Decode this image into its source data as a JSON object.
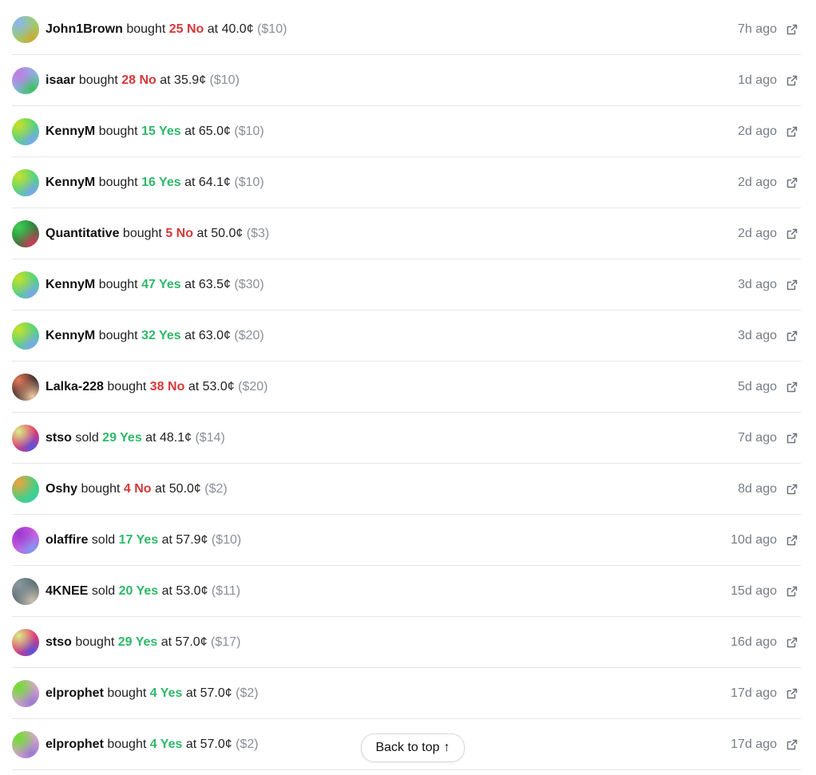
{
  "trades": [
    {
      "user": "John1Brown",
      "action": "bought",
      "quantity": "25 No",
      "outcome": "no",
      "at": "at",
      "price": "40.0¢",
      "amount": "($10)",
      "time": "7h ago",
      "avatar_colors": [
        "#8ab4ef",
        "#9ad26b",
        "#c9a83a"
      ]
    },
    {
      "user": "isaar",
      "action": "bought",
      "quantity": "28 No",
      "outcome": "no",
      "at": "at",
      "price": "35.9¢",
      "amount": "($10)",
      "time": "1d ago",
      "avatar_colors": [
        "#c17ae0",
        "#8cb4e6",
        "#3ec05a"
      ]
    },
    {
      "user": "KennyM",
      "action": "bought",
      "quantity": "15 Yes",
      "outcome": "yes",
      "at": "at",
      "price": "65.0¢",
      "amount": "($10)",
      "time": "2d ago",
      "avatar_colors": [
        "#c8e02a",
        "#4bd67a",
        "#7aa6ee"
      ]
    },
    {
      "user": "KennyM",
      "action": "bought",
      "quantity": "16 Yes",
      "outcome": "yes",
      "at": "at",
      "price": "64.1¢",
      "amount": "($10)",
      "time": "2d ago",
      "avatar_colors": [
        "#c8e02a",
        "#4bd67a",
        "#7aa6ee"
      ]
    },
    {
      "user": "Quantitative",
      "action": "bought",
      "quantity": "5 No",
      "outcome": "no",
      "at": "at",
      "price": "50.0¢",
      "amount": "($3)",
      "time": "2d ago",
      "avatar_colors": [
        "#3ecf52",
        "#2a7c3a",
        "#d03a5a"
      ]
    },
    {
      "user": "KennyM",
      "action": "bought",
      "quantity": "47 Yes",
      "outcome": "yes",
      "at": "at",
      "price": "63.5¢",
      "amount": "($30)",
      "time": "3d ago",
      "avatar_colors": [
        "#c8e02a",
        "#4bd67a",
        "#7aa6ee"
      ]
    },
    {
      "user": "KennyM",
      "action": "bought",
      "quantity": "32 Yes",
      "outcome": "yes",
      "at": "at",
      "price": "63.0¢",
      "amount": "($20)",
      "time": "3d ago",
      "avatar_colors": [
        "#c8e02a",
        "#4bd67a",
        "#7aa6ee"
      ]
    },
    {
      "user": "Lalka-228",
      "action": "bought",
      "quantity": "38 No",
      "outcome": "no",
      "at": "at",
      "price": "53.0¢",
      "amount": "($20)",
      "time": "5d ago",
      "avatar_colors": [
        "#e27a5a",
        "#3a2a2a",
        "#f2c8a0"
      ]
    },
    {
      "user": "stso",
      "action": "sold",
      "quantity": "29 Yes",
      "outcome": "yes",
      "at": "at",
      "price": "48.1¢",
      "amount": "($14)",
      "time": "7d ago",
      "avatar_colors": [
        "#d8f08a",
        "#e8346a",
        "#5a52e0"
      ]
    },
    {
      "user": "Oshy",
      "action": "bought",
      "quantity": "4 No",
      "outcome": "no",
      "at": "at",
      "price": "50.0¢",
      "amount": "($2)",
      "time": "8d ago",
      "avatar_colors": [
        "#f2a23a",
        "#44d080",
        "#3ecf9a"
      ]
    },
    {
      "user": "olaffire",
      "action": "sold",
      "quantity": "17 Yes",
      "outcome": "yes",
      "at": "at",
      "price": "57.9¢",
      "amount": "($10)",
      "time": "10d ago",
      "avatar_colors": [
        "#9a3ad0",
        "#d05ae0",
        "#7a9af0"
      ]
    },
    {
      "user": "4KNEE",
      "action": "sold",
      "quantity": "20 Yes",
      "outcome": "yes",
      "at": "at",
      "price": "53.0¢",
      "amount": "($11)",
      "time": "15d ago",
      "avatar_colors": [
        "#8a9aa0",
        "#5a6a70",
        "#c8c0b0"
      ]
    },
    {
      "user": "stso",
      "action": "bought",
      "quantity": "29 Yes",
      "outcome": "yes",
      "at": "at",
      "price": "57.0¢",
      "amount": "($17)",
      "time": "16d ago",
      "avatar_colors": [
        "#d8f08a",
        "#e8346a",
        "#5a52e0"
      ]
    },
    {
      "user": "elprophet",
      "action": "bought",
      "quantity": "4 Yes",
      "outcome": "yes",
      "at": "at",
      "price": "57.0¢",
      "amount": "($2)",
      "time": "17d ago",
      "avatar_colors": [
        "#6ae02a",
        "#d8a8c8",
        "#9a7ad0"
      ]
    },
    {
      "user": "elprophet",
      "action": "bought",
      "quantity": "4 Yes",
      "outcome": "yes",
      "at": "at",
      "price": "57.0¢",
      "amount": "($2)",
      "time": "17d ago",
      "avatar_colors": [
        "#6ae02a",
        "#d8a8c8",
        "#9a7ad0"
      ]
    }
  ],
  "back_to_top": {
    "label": "Back to top",
    "arrow": "↑"
  },
  "colors": {
    "no": "#d63838",
    "yes": "#2fb86a",
    "muted": "#8a8f98",
    "divider": "#e6e6e6"
  }
}
